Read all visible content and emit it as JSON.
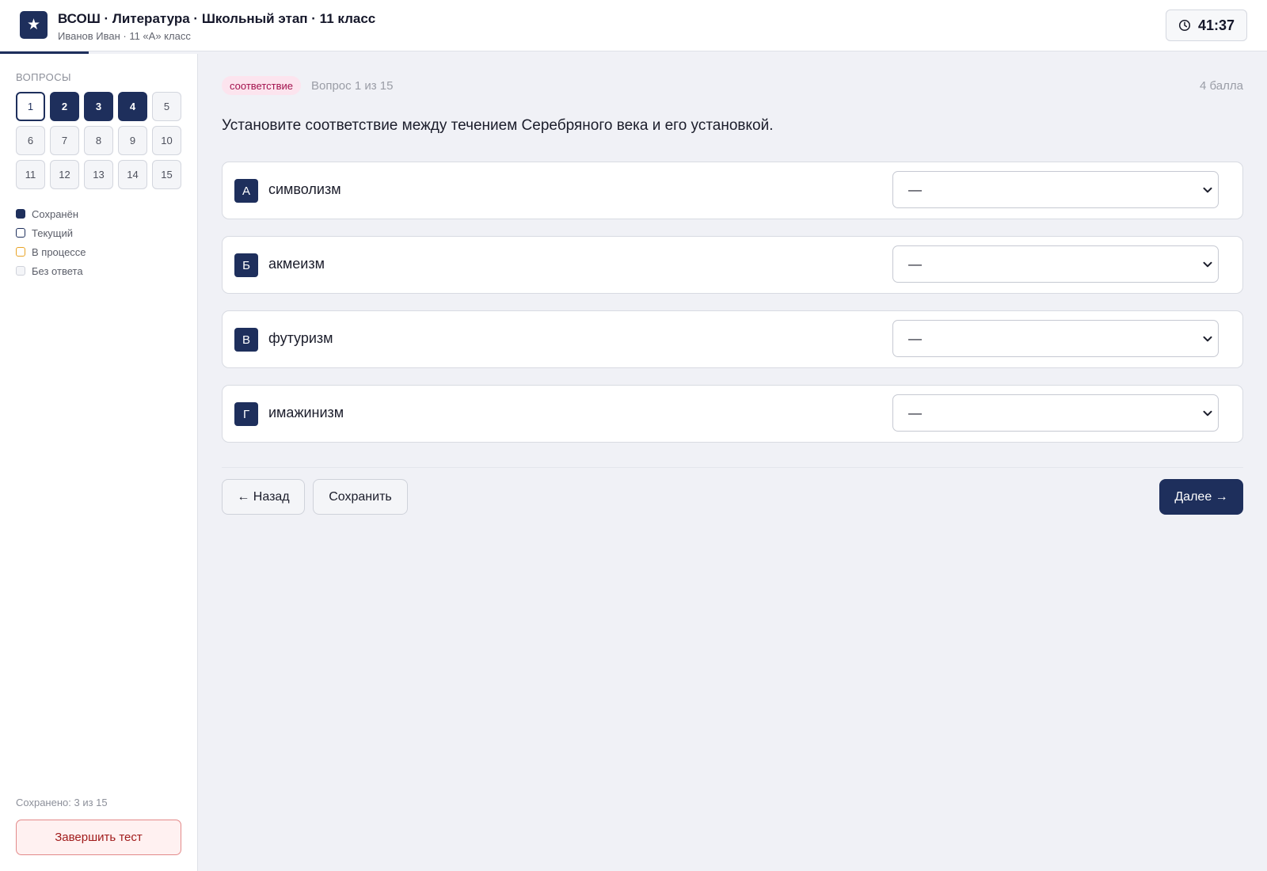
{
  "header": {
    "logo_glyph": "★",
    "title": "ВСОШ · Литература · Школьный этап · 11 класс",
    "subtitle": "Иванов Иван · 11 «А» класс",
    "timer": "41:37",
    "timer_icon": "clock-icon"
  },
  "progress": {
    "fraction": 0.07
  },
  "sidebar": {
    "heading": "ВОПРОСЫ",
    "questions": [
      {
        "label": "1",
        "state": "current"
      },
      {
        "label": "2",
        "state": "saved"
      },
      {
        "label": "3",
        "state": "saved"
      },
      {
        "label": "4",
        "state": "saved"
      },
      {
        "label": "5",
        "state": "none"
      },
      {
        "label": "6",
        "state": "none"
      },
      {
        "label": "7",
        "state": "none"
      },
      {
        "label": "8",
        "state": "none"
      },
      {
        "label": "9",
        "state": "none"
      },
      {
        "label": "10",
        "state": "none"
      },
      {
        "label": "11",
        "state": "none"
      },
      {
        "label": "12",
        "state": "none"
      },
      {
        "label": "13",
        "state": "none"
      },
      {
        "label": "14",
        "state": "none"
      },
      {
        "label": "15",
        "state": "none"
      }
    ],
    "legend": [
      {
        "key": "saved",
        "label": "Сохранён"
      },
      {
        "key": "current",
        "label": "Текущий"
      },
      {
        "key": "progress",
        "label": "В процессе"
      },
      {
        "key": "none",
        "label": "Без ответа"
      }
    ],
    "saved_count": "Сохранено: 3 из 15",
    "finish_label": "Завершить тест"
  },
  "question": {
    "type_badge": "соответствие",
    "counter": "Вопрос 1 из 15",
    "points": "4 балла",
    "text": "Установите соответствие между течением Серебряного века и его установкой.",
    "rows": [
      {
        "letter": "А",
        "term": "символизм",
        "selected": "—"
      },
      {
        "letter": "Б",
        "term": "акмеизм",
        "selected": "—"
      },
      {
        "letter": "В",
        "term": "футуризм",
        "selected": "—"
      },
      {
        "letter": "Г",
        "term": "имажинизм",
        "selected": "—"
      }
    ]
  },
  "nav": {
    "back_label": "← Назад",
    "save_label": "Сохранить",
    "next_label": "Далее →"
  },
  "colors": {
    "accent": "#1e2f5c",
    "badge_bg": "#fce4ee",
    "badge_text": "#a3124d",
    "finish_border": "#e38a8a",
    "in_progress": "#e8a325"
  }
}
